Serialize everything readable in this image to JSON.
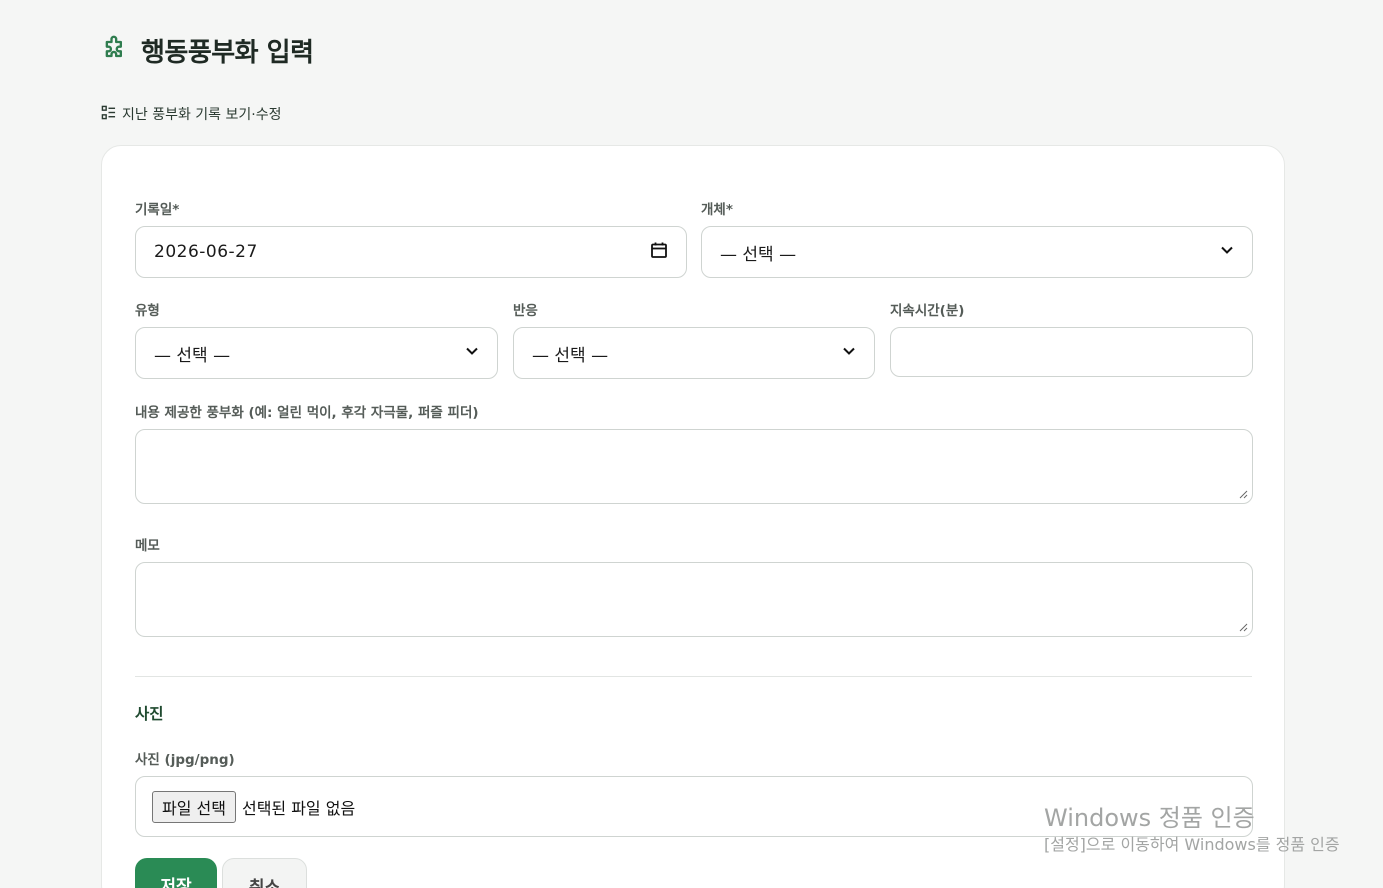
{
  "page": {
    "title": "행동풍부화 입력",
    "history_link": "지난 풍부화 기록 보기·수정"
  },
  "form": {
    "date": {
      "label": "기록일*",
      "value": "2026-06-27"
    },
    "animal": {
      "label": "개체*",
      "value": "— 선택 —"
    },
    "type": {
      "label": "유형",
      "value": "— 선택 —"
    },
    "reaction": {
      "label": "반응",
      "value": "— 선택 —"
    },
    "duration": {
      "label": "지속시간(분)",
      "value": ""
    },
    "content": {
      "label": "내용 제공한 풍부화 (예: 얼린 먹이, 후각 자극물, 퍼즐 피더)",
      "value": ""
    },
    "memo": {
      "label": "메모",
      "value": ""
    }
  },
  "photo": {
    "section_title": "사진",
    "label": "사진 (jpg/png)",
    "file_button": "파일 선택",
    "file_status": "선택된 파일 없음"
  },
  "actions": {
    "save": "저장",
    "cancel": "취소"
  },
  "watermark": {
    "title": "Windows 정품 인증",
    "subtitle": "[설정]으로 이동하여 Windows를 정품 인증"
  },
  "colors": {
    "accent": "#2a8b55",
    "icon_green": "#2f7d4f",
    "background": "#f5f6f5",
    "card": "#ffffff"
  },
  "icons": {
    "title": "puzzle-icon",
    "history": "list-icon",
    "date": "calendar-icon",
    "select": "chevron-down-icon"
  }
}
